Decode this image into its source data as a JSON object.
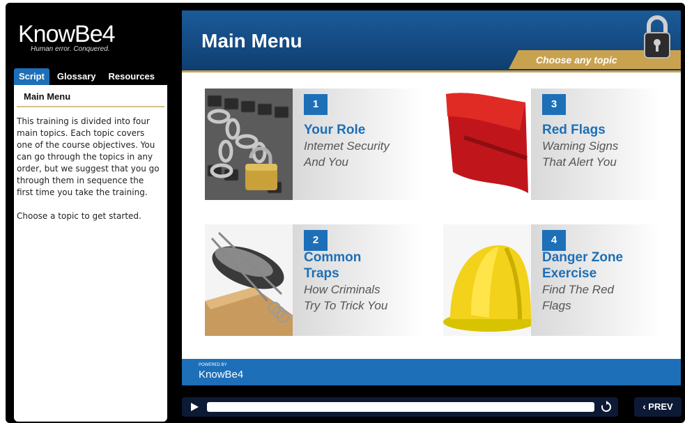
{
  "sidebar": {
    "logo_text": "KnowBe4",
    "logo_tagline": "Human error. Conquered.",
    "tabs": [
      {
        "label": "Script",
        "active": true
      },
      {
        "label": "Glossary",
        "active": false
      },
      {
        "label": "Resources",
        "active": false
      }
    ],
    "panel_title": "Main Menu",
    "paragraphs": [
      "This training is divided into four main topics. Each topic covers one of the course objectives. You can go through the topics in any order, but we suggest that you go through them in sequence the first time you take the training.",
      "Choose a topic to get started."
    ]
  },
  "header": {
    "title": "Main Menu",
    "banner": "Choose any topic",
    "lock_icon": "padlock-icon"
  },
  "topics": [
    {
      "number": "1",
      "title": "Your Role",
      "subtitle_lines": [
        "Intemet Security",
        "And You"
      ],
      "image": "chain-keyboard-image"
    },
    {
      "number": "2",
      "title_lines": [
        "Common",
        "Traps"
      ],
      "subtitle_lines": [
        "How Criminals",
        "Try To Trick You"
      ],
      "image": "mousetrap-image"
    },
    {
      "number": "3",
      "title": "Red Flags",
      "subtitle_lines": [
        "Waming Signs",
        "That Alert You"
      ],
      "image": "red-flag-image"
    },
    {
      "number": "4",
      "title_lines": [
        "Danger Zone",
        "Exercise"
      ],
      "subtitle_lines": [
        "Find The Red",
        "Flags"
      ],
      "image": "hard-hat-image"
    }
  ],
  "footer": {
    "powered_by": "POWERED BY",
    "logo_text": "KnowBe4"
  },
  "controls": {
    "prev_label": "‹ PREV",
    "play_icon": "play-icon",
    "replay_icon": "replay-icon"
  },
  "colors": {
    "accent_blue": "#1d6fb8",
    "gold": "#c9a24f",
    "header_dark": "#0f3e70"
  }
}
